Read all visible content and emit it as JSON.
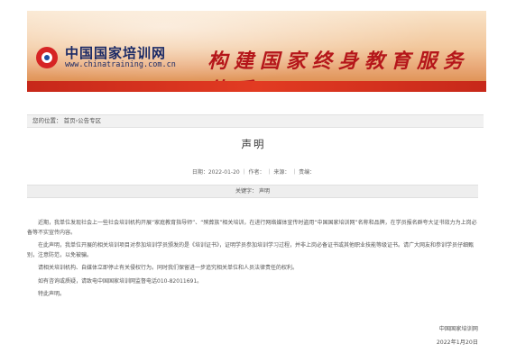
{
  "header": {
    "logo_cn": "中国国家培训网",
    "logo_en": "www.chinatraining.com.cn",
    "slogan": "构建国家终身教育服务体系"
  },
  "breadcrumb": "您的位置：  首页›公告专区",
  "article": {
    "title": "声明",
    "meta": "日期：2022-01-20  ｜ 作者：   ｜ 来源：   ｜ 责编：",
    "keywords": "关键字：  声明",
    "paragraphs": [
      "近期，我单位发现社会上一些社会培训机构开展“家庭教育指导师”、“殡葬族”相关培训，在进行网络媒体宣传时盗用“中国国家培训网”名称和品牌，在学员报名群夸大证书效力为上岗必备等不实宣传内容。",
      "在此声明，我单位开展的相关培训项目对参加培训学员颁发的是《培训证书》，证明学员参加培训学习过程，并非上岗必备证书或其他职业技能等级证书。请广大网友和参训学员仔细甄别，注意防范，以免被骗。",
      "请相关培训机构、自媒体立即停止有关侵权行为。同时我们保留进一步追究相关单位和人员法律责任的权利。",
      "如有咨询或质疑，请致电中国国家培训网监督电话010-82011691。",
      "特此声明。"
    ],
    "signature_org": "中国国家培训网",
    "signature_date": "2022年1月20日"
  },
  "colors": {
    "brand_red": "#d62424",
    "brand_blue": "#1b2a66"
  }
}
